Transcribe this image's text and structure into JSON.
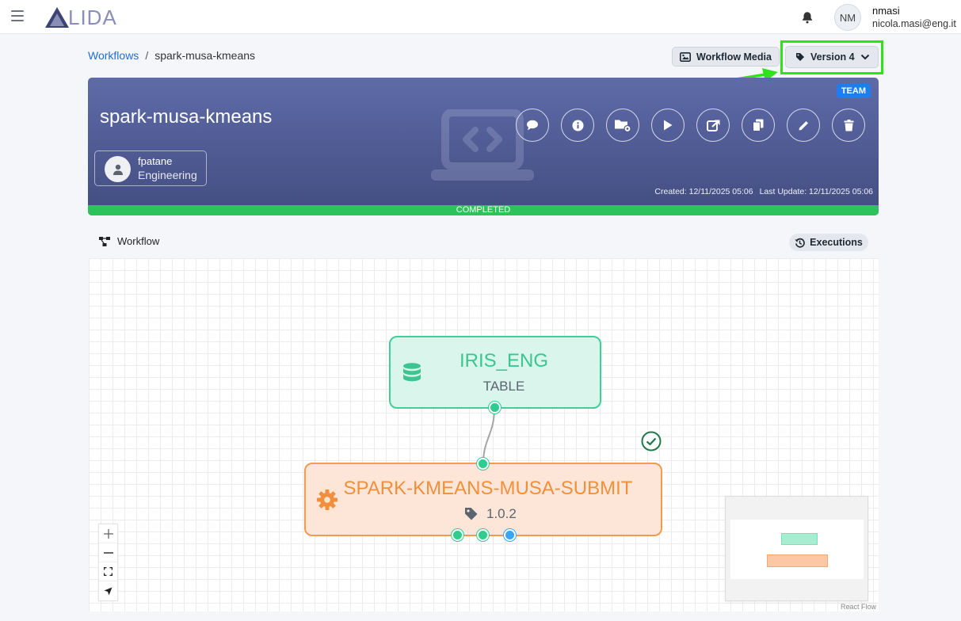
{
  "header": {
    "logo_text": "LIDA",
    "user_initials": "NM",
    "user_name": "nmasi",
    "user_email": "nicola.masi@eng.it"
  },
  "breadcrumb": {
    "root": "Workflows",
    "separator": "/",
    "current": "spark-musa-kmeans"
  },
  "toolbar": {
    "media_label": "Workflow Media",
    "version_label": "Version 4"
  },
  "card": {
    "title": "spark-musa-kmeans",
    "badge": "TEAM",
    "owner_name": "fpatane",
    "owner_dept": "Engineering",
    "created": "Created: 12/11/2025 05:06",
    "updated": "Last Update: 12/11/2025 05:06",
    "status": "COMPLETED",
    "status_color": "#2cc45a"
  },
  "workflow": {
    "section_label": "Workflow",
    "executions_label": "Executions",
    "nodes": [
      {
        "title": "IRIS_ENG",
        "subtitle": "TABLE"
      },
      {
        "title": "SPARK-KMEANS-MUSA-SUBMIT",
        "version": "1.0.2"
      }
    ],
    "attribution": "React Flow"
  },
  "colors": {
    "accent": "#1f6fd6",
    "highlight": "#2ee31a",
    "table_node": "#3ecf9a",
    "service_node": "#f39a4b"
  }
}
